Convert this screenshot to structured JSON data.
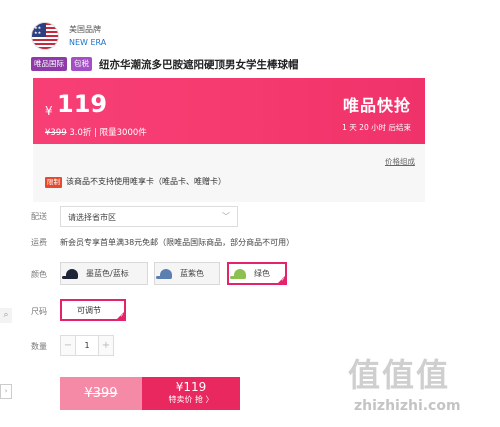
{
  "brand": {
    "name_cn": "美国品牌",
    "name_en": "NEW ERA",
    "flag_icon": "us-flag-icon"
  },
  "product": {
    "tags": [
      "唯品国际",
      "包税"
    ],
    "title": "纽亦华潮流多巴胺遮阳硬顶男女学生棒球帽"
  },
  "price": {
    "currency": "¥",
    "current": "119",
    "original": "¥399",
    "discount": "3.0折",
    "limit": "| 限量3000件",
    "flash_title": "唯品快抢",
    "countdown": "1 天 20 小时 后结束"
  },
  "info": {
    "price_compose_link": "价格组成",
    "limit_tag": "限制",
    "limit_text": "该商品不支持使用唯享卡（唯品卡、唯赠卡）"
  },
  "delivery": {
    "label": "配送",
    "placeholder": "请选择省市区"
  },
  "freight": {
    "label": "运费",
    "text": "新会员专享首单满38元免邮（限唯品国际商品，部分商品不可用）"
  },
  "color": {
    "label": "颜色",
    "options": [
      {
        "name": "墨蓝色/蓝标",
        "cap_color": "#1e2536",
        "selected": false
      },
      {
        "name": "蓝紫色",
        "cap_color": "#5a7fb0",
        "selected": false
      },
      {
        "name": "绿色",
        "cap_color": "#8cc152",
        "selected": true
      }
    ]
  },
  "size": {
    "label": "尺码",
    "options": [
      {
        "name": "可调节",
        "selected": true
      }
    ]
  },
  "quantity": {
    "label": "数量",
    "minus": "−",
    "value": "1",
    "plus": "+"
  },
  "buttons": {
    "normal_price": "¥399",
    "flash_price": "¥119",
    "flash_label": "特卖价 抢 〉"
  },
  "watermark": {
    "big": "值值值",
    "small": "zhizhizhi.com"
  },
  "side": {
    "search_glyph": "🔍",
    "chevron_glyph": "›"
  },
  "colors": {
    "accent": "#e4236a",
    "price_banner": "#f53a6f",
    "intl_tag": "#8e3aa9",
    "tax_tag": "#a44fc5",
    "brand_link": "#1a73c9"
  }
}
